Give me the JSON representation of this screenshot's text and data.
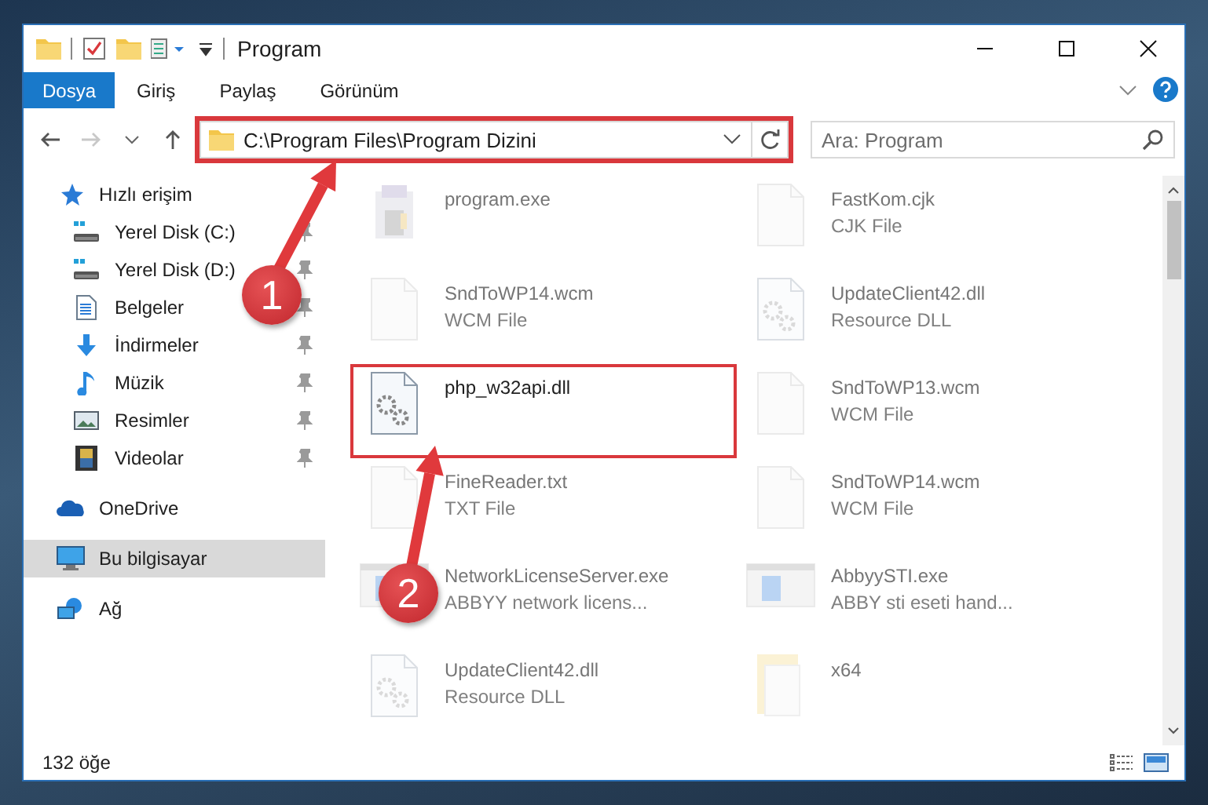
{
  "window": {
    "title": "Program"
  },
  "ribbon_tabs": [
    {
      "label": "Dosya",
      "kind": "file"
    },
    {
      "label": "Giriş",
      "kind": "tab"
    },
    {
      "label": "Paylaş",
      "kind": "tab"
    },
    {
      "label": "Görünüm",
      "kind": "tab"
    }
  ],
  "address_bar": {
    "path": "C:\\Program Files\\Program Dizini",
    "highlighted": true
  },
  "search": {
    "placeholder": "Ara: Program"
  },
  "sidebar": {
    "items": [
      {
        "label": "Hızlı erişim",
        "kind": "star",
        "selected": false,
        "children": [
          {
            "label": "Yerel Disk (C:)",
            "kind": "drive",
            "pinned": true,
            "selected": false
          },
          {
            "label": "Yerel Disk (D:)",
            "kind": "drive",
            "pinned": true,
            "selected": false
          },
          {
            "label": "Belgeler",
            "kind": "document",
            "pinned": true,
            "selected": false
          },
          {
            "label": "İndirmeler",
            "kind": "download",
            "pinned": true,
            "selected": false
          },
          {
            "label": "Müzik",
            "kind": "music",
            "pinned": true,
            "selected": false
          },
          {
            "label": "Resimler",
            "kind": "picture",
            "pinned": true,
            "selected": false
          },
          {
            "label": "Videolar",
            "kind": "film",
            "pinned": true,
            "selected": false
          }
        ]
      },
      {
        "label": "OneDrive",
        "kind": "cloud",
        "selected": false
      },
      {
        "label": "Bu bilgisayar",
        "kind": "computer",
        "selected": true
      },
      {
        "label": "Ağ",
        "kind": "network",
        "selected": false
      }
    ]
  },
  "files": [
    {
      "name": "program.exe",
      "kind": "exe",
      "highlighted": false
    },
    {
      "name": "FastKom.cjk",
      "type": "CJK File",
      "kind": "blank",
      "highlighted": false
    },
    {
      "name": "SndToWP14.wcm",
      "type": "WCM File",
      "kind": "blank",
      "highlighted": false
    },
    {
      "name": "UpdateClient42.dll",
      "type": "Resource DLL",
      "kind": "dll",
      "highlighted": false
    },
    {
      "name": "php_w32api.dll",
      "kind": "dll",
      "highlighted": true
    },
    {
      "name": "SndToWP13.wcm",
      "type": "WCM File",
      "kind": "blank",
      "highlighted": false
    },
    {
      "name": "FineReader.txt",
      "type": "TXT File",
      "kind": "blank",
      "highlighted": false
    },
    {
      "name": "SndToWP14.wcm",
      "type": "WCM File",
      "kind": "blank",
      "highlighted": false
    },
    {
      "name": "NetworkLicenseServer.exe",
      "type": "ABBYY network licens...",
      "kind": "app",
      "highlighted": false
    },
    {
      "name": "AbbyySTI.exe",
      "type": "ABBY sti eseti hand...",
      "kind": "app",
      "highlighted": false
    },
    {
      "name": "UpdateClient42.dll",
      "type": "Resource DLL",
      "kind": "dll",
      "highlighted": false
    },
    {
      "name": "x64",
      "kind": "folder",
      "highlighted": false
    }
  ],
  "status_bar": {
    "count": "132 öğe"
  },
  "annotations": [
    {
      "number": "1"
    },
    {
      "number": "2"
    }
  ]
}
